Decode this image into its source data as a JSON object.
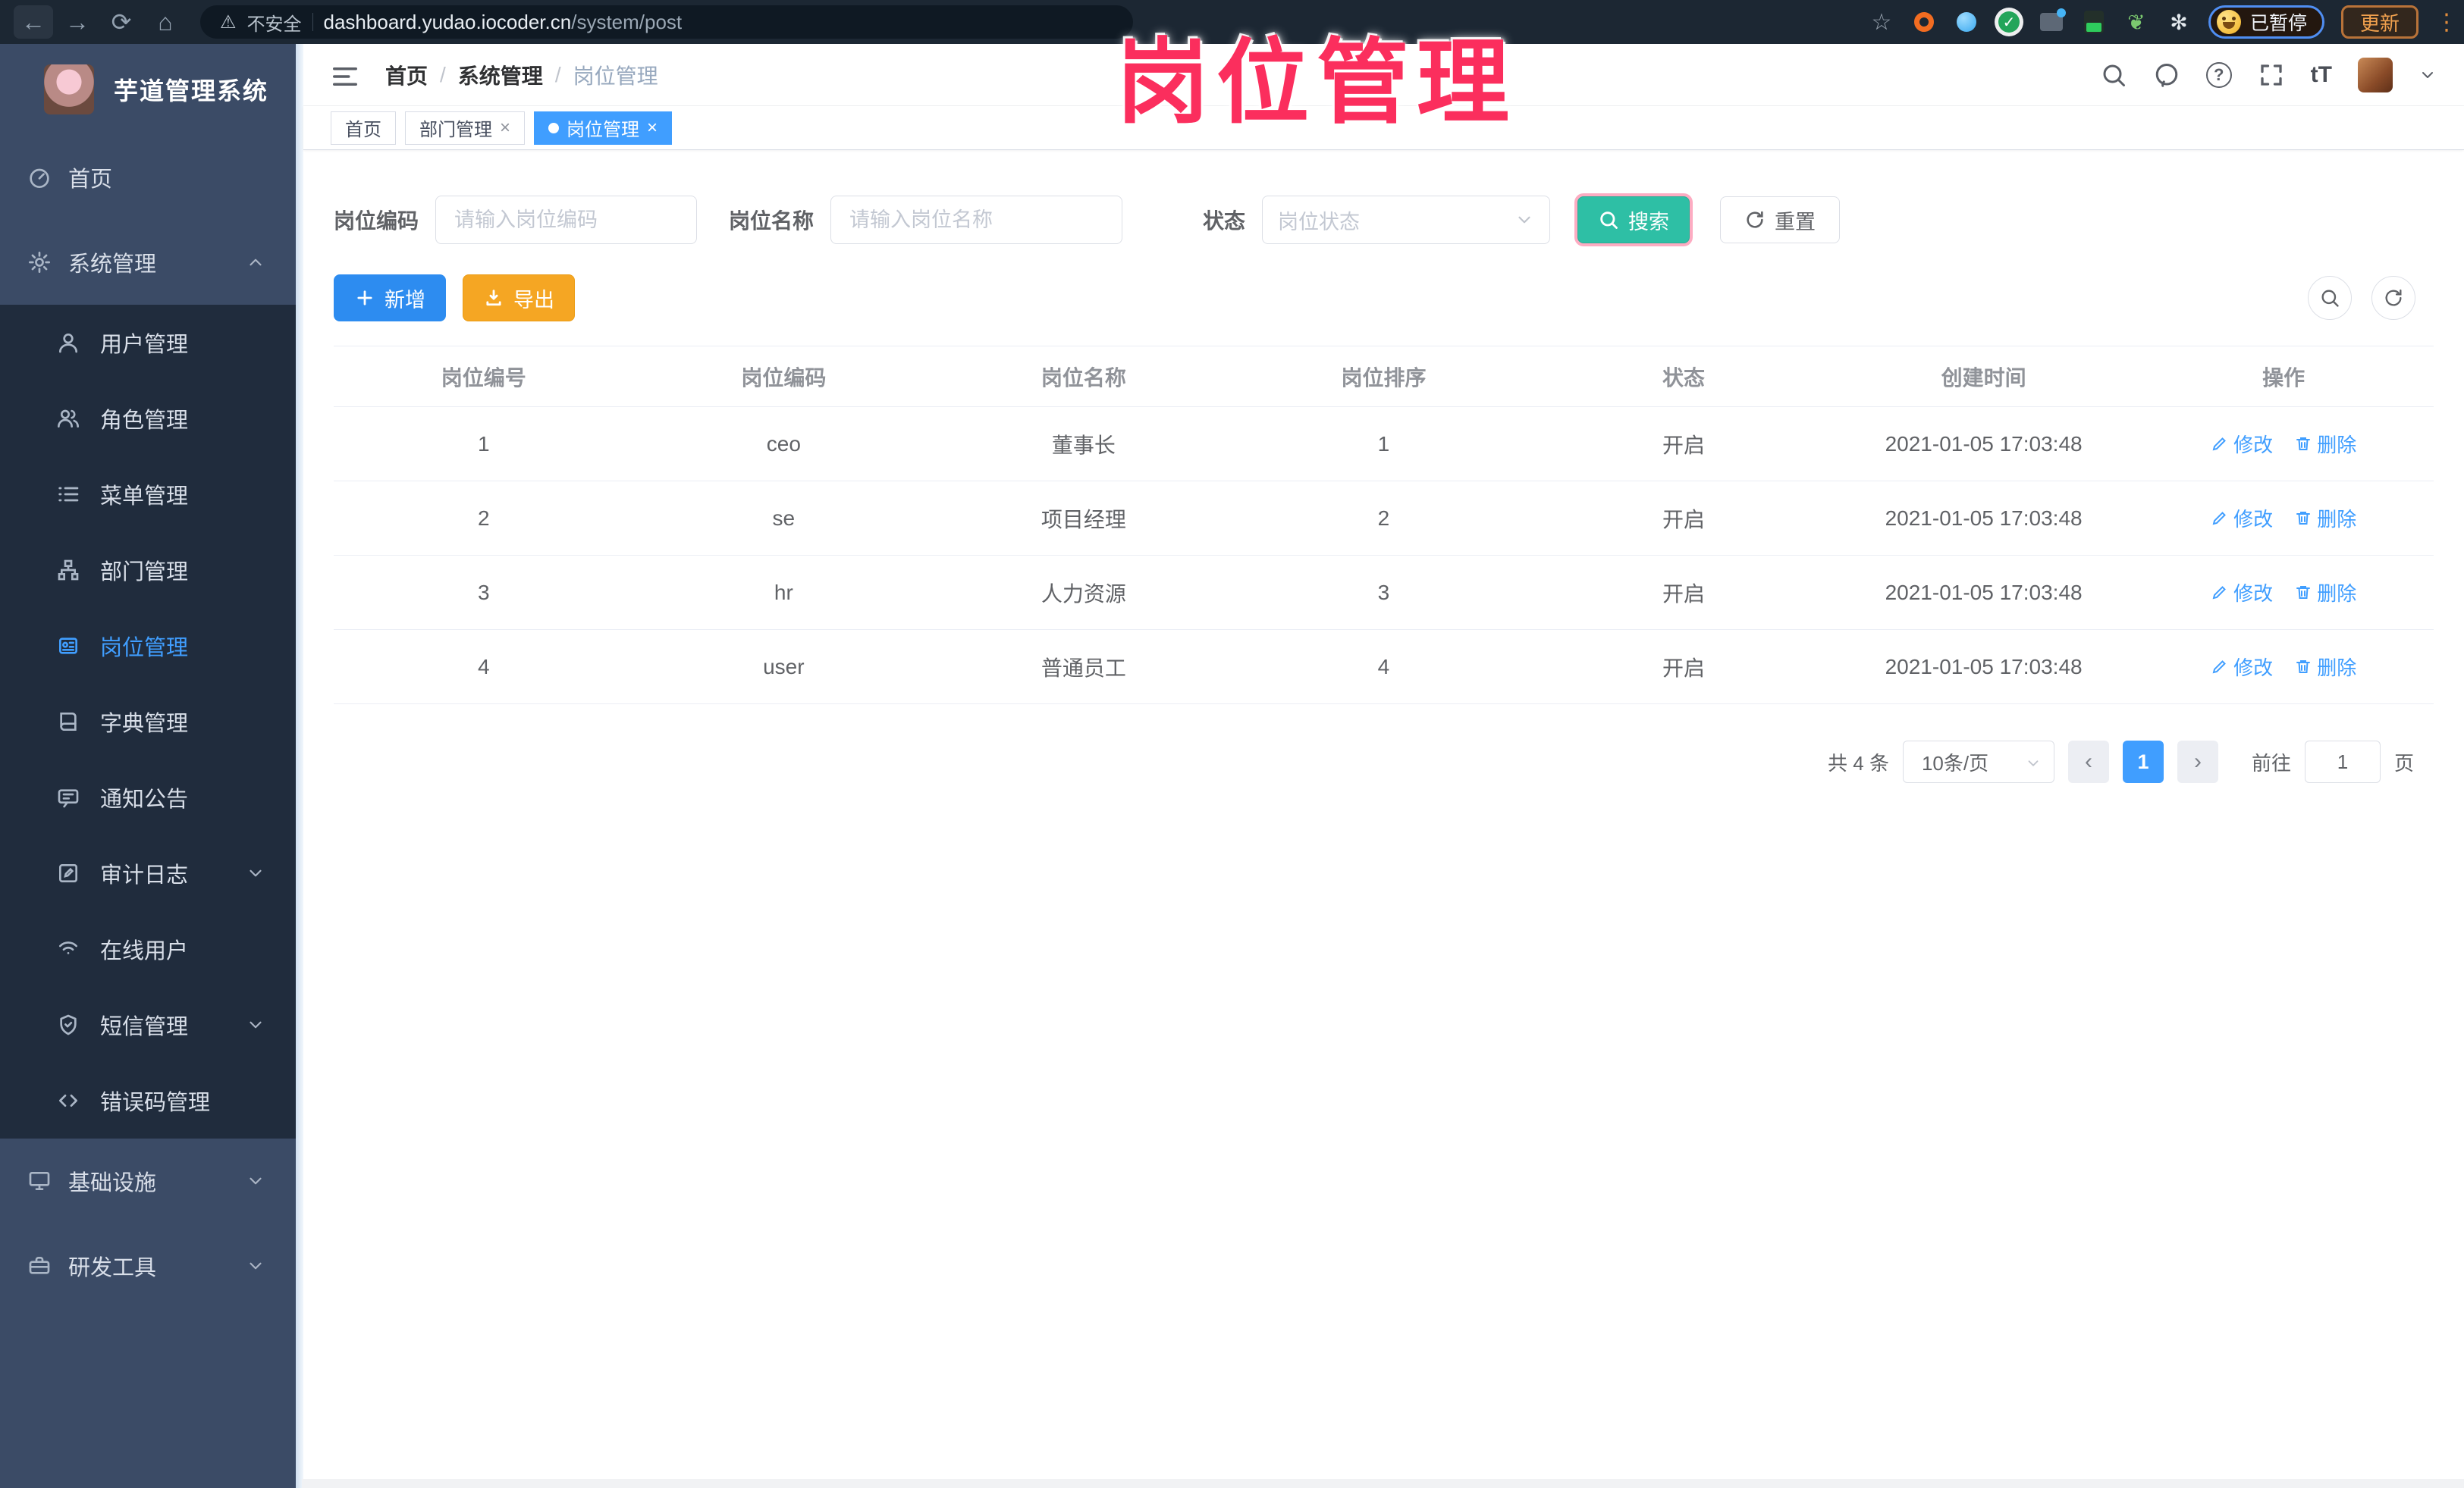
{
  "colors": {
    "accent": "#409eff",
    "search_teal": "#2ebfa5",
    "export_orange": "#f5a623",
    "add_blue": "#2d8cf0",
    "annotation_pink": "#fb2e5d",
    "sidebar_bg": "#3b4b66",
    "submenu_bg": "#202c3d"
  },
  "browser": {
    "nav_icons": [
      "back-arrow",
      "forward-arrow",
      "reload",
      "home"
    ],
    "back_glyph": "←",
    "forward_glyph": "→",
    "reload_glyph": "⟳",
    "home_glyph": "⌂",
    "security_label": "不安全",
    "warn_glyph": "⚠",
    "url_domain": "dashboard.yudao.iocoder.cn",
    "url_path": "/system/post",
    "extension_icons": [
      "star",
      "orange-ring",
      "blue-pin",
      "green-check",
      "gray-grid",
      "green-card",
      "sprout",
      "paw"
    ],
    "star_glyph": "☆",
    "sprout_glyph": "❦",
    "paw_glyph": "✻",
    "check_glyph": "✓",
    "paused_badge": "已暂停",
    "update_button": "更新",
    "menu_dots_glyph": "⋮"
  },
  "overlay": {
    "title": "岗位管理"
  },
  "sidebar": {
    "logo_title": "芋道管理系统",
    "items": [
      {
        "label": "首页",
        "icon": "gauge-icon"
      },
      {
        "label": "系统管理",
        "icon": "gear-icon",
        "expanded": true
      },
      {
        "label": "用户管理",
        "icon": "user-icon"
      },
      {
        "label": "角色管理",
        "icon": "users-icon"
      },
      {
        "label": "菜单管理",
        "icon": "list-icon"
      },
      {
        "label": "部门管理",
        "icon": "org-tree-icon"
      },
      {
        "label": "岗位管理",
        "icon": "badge-icon",
        "active": true
      },
      {
        "label": "字典管理",
        "icon": "book-icon"
      },
      {
        "label": "通知公告",
        "icon": "megaphone-icon"
      },
      {
        "label": "审计日志",
        "icon": "edit-square-icon",
        "collapsible": true
      },
      {
        "label": "在线用户",
        "icon": "signal-icon"
      },
      {
        "label": "短信管理",
        "icon": "shield-icon",
        "collapsible": true
      },
      {
        "label": "错误码管理",
        "icon": "code-icon"
      },
      {
        "label": "基础设施",
        "icon": "monitor-icon",
        "collapsible": true
      },
      {
        "label": "研发工具",
        "icon": "toolbox-icon",
        "collapsible": true
      }
    ]
  },
  "header": {
    "breadcrumb": [
      "首页",
      "系统管理",
      "岗位管理"
    ],
    "separator": "/",
    "right_icons": [
      "search-icon",
      "github-icon",
      "help-icon",
      "fullscreen-icon",
      "font-size-icon",
      "avatar",
      "chevron-down-icon"
    ],
    "font_size_icon_text": "tT"
  },
  "tabs": {
    "close_glyph": "×",
    "items": [
      {
        "label": "首页",
        "closable": false,
        "active": false
      },
      {
        "label": "部门管理",
        "closable": true,
        "active": false
      },
      {
        "label": "岗位管理",
        "closable": true,
        "active": true
      }
    ]
  },
  "filters": {
    "code_label": "岗位编码",
    "code_placeholder": "请输入岗位编码",
    "name_label": "岗位名称",
    "name_placeholder": "请输入岗位名称",
    "status_label": "状态",
    "status_placeholder": "岗位状态",
    "search_label": "搜索",
    "reset_label": "重置"
  },
  "toolbar": {
    "add_label": "新增",
    "export_label": "导出",
    "circle_icons": [
      "magnifier-icon",
      "refresh-icon"
    ]
  },
  "table": {
    "columns": [
      "岗位编号",
      "岗位编码",
      "岗位名称",
      "岗位排序",
      "状态",
      "创建时间",
      "操作"
    ],
    "rows": [
      [
        "1",
        "ceo",
        "董事长",
        "1",
        "开启",
        "2021-01-05 17:03:48"
      ],
      [
        "2",
        "se",
        "项目经理",
        "2",
        "开启",
        "2021-01-05 17:03:48"
      ],
      [
        "3",
        "hr",
        "人力资源",
        "3",
        "开启",
        "2021-01-05 17:03:48"
      ],
      [
        "4",
        "user",
        "普通员工",
        "4",
        "开启",
        "2021-01-05 17:03:48"
      ]
    ],
    "edit_label": "修改",
    "delete_label": "删除"
  },
  "pagination": {
    "total": "共 4 条",
    "page_size": "10条/页",
    "prev_glyph": "‹",
    "next_glyph": "›",
    "current_page": "1",
    "goto_label": "前往",
    "goto_value": "1",
    "page_unit": "页"
  }
}
